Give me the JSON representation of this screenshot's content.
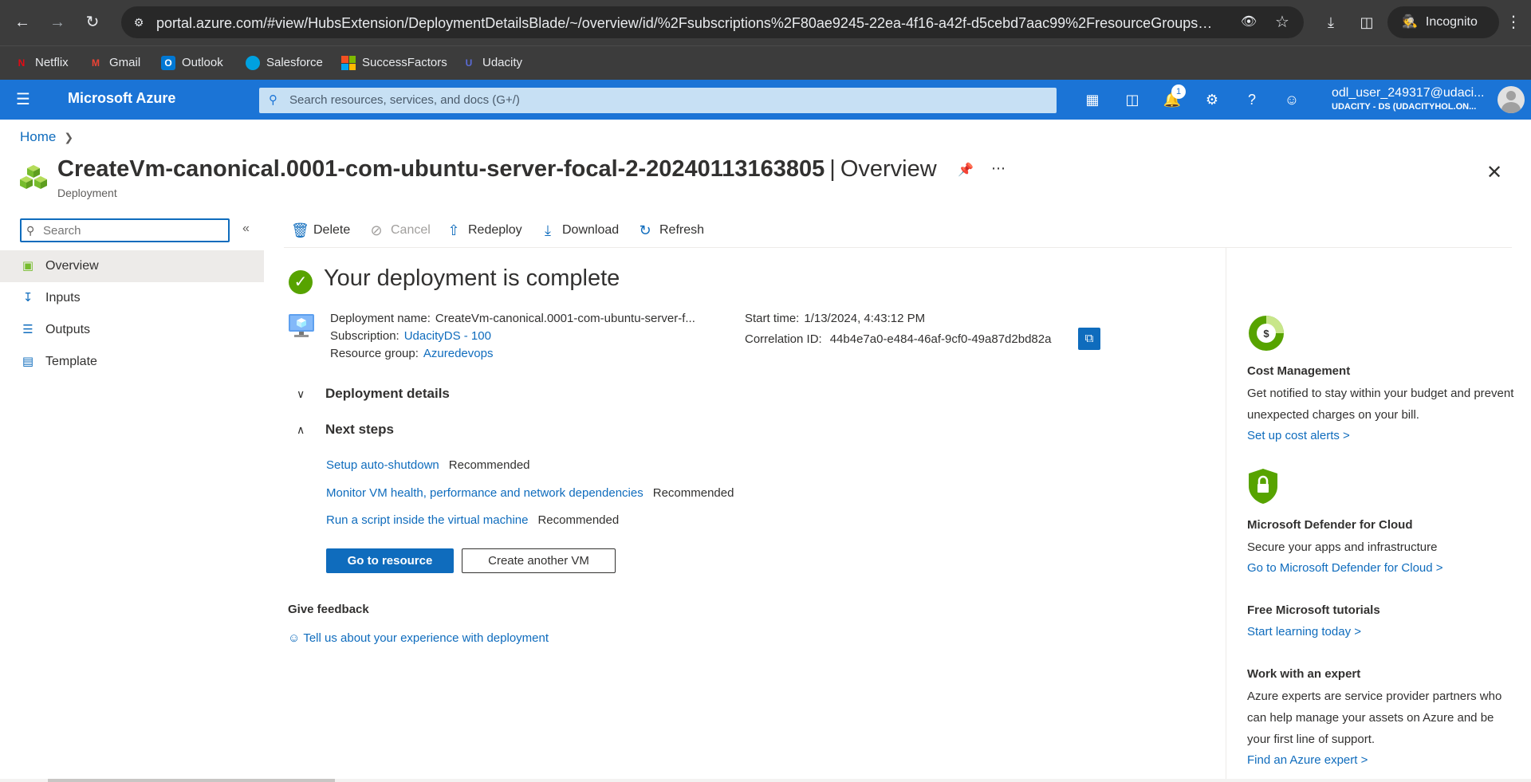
{
  "browser": {
    "url": "portal.azure.com/#view/HubsExtension/DeploymentDetailsBlade/~/overview/id/%2Fsubscriptions%2F80ae9245-22ea-4f16-a42f-d5cebd7aac99%2FresourceGroups%2FAzure...",
    "incognito_label": "Incognito",
    "bookmarks": [
      {
        "label": "Netflix",
        "icon": "netflix-icon",
        "color": "#e50914"
      },
      {
        "label": "Gmail",
        "icon": "gmail-icon",
        "color": "#ea4335"
      },
      {
        "label": "Outlook",
        "icon": "outlook-icon",
        "color": "#0078d4"
      },
      {
        "label": "Salesforce",
        "icon": "salesforce-icon",
        "color": "#00a1e0"
      },
      {
        "label": "SuccessFactors",
        "icon": "microsoft-icon",
        "color": "#f25022"
      },
      {
        "label": "Udacity",
        "icon": "udacity-icon",
        "color": "#5a6bd6"
      }
    ]
  },
  "azure": {
    "brand": "Microsoft Azure",
    "search_placeholder": "Search resources, services, and docs (G+/)",
    "notification_count": "1",
    "user": "odl_user_249317@udaci...",
    "tenant": "UDACITY - DS (UDACITYHOL.ON...",
    "accent": "#1b74d6"
  },
  "breadcrumb": {
    "home": "Home"
  },
  "blade": {
    "title": "CreateVm-canonical.0001-com-ubuntu-server-focal-2-20240113163805",
    "separator": "|",
    "section": "Overview",
    "subtitle": "Deployment"
  },
  "leftnav": {
    "search_placeholder": "Search",
    "items": [
      {
        "label": "Overview",
        "icon": "overview-icon"
      },
      {
        "label": "Inputs",
        "icon": "inputs-icon"
      },
      {
        "label": "Outputs",
        "icon": "outputs-icon"
      },
      {
        "label": "Template",
        "icon": "template-icon"
      }
    ]
  },
  "commands": {
    "delete": "Delete",
    "cancel": "Cancel",
    "redeploy": "Redeploy",
    "download": "Download",
    "refresh": "Refresh"
  },
  "deployment": {
    "status": "Your deployment is complete",
    "name_label": "Deployment name:",
    "name_value": "CreateVm-canonical.0001-com-ubuntu-server-f...",
    "subscription_label": "Subscription:",
    "subscription_value": "UdacityDS - 100",
    "rg_label": "Resource group:",
    "rg_value": "Azuredevops",
    "start_label": "Start time:",
    "start_value": "1/13/2024, 4:43:12 PM",
    "corr_label": "Correlation ID:",
    "corr_value": "44b4e7a0-e484-46af-9cf0-49a87d2bd82a",
    "success_color": "#57a300"
  },
  "sections": {
    "details": "Deployment details",
    "next_steps": "Next steps"
  },
  "next_steps": [
    {
      "link": "Setup auto-shutdown",
      "tag": "Recommended"
    },
    {
      "link": "Monitor VM health, performance and network dependencies",
      "tag": "Recommended"
    },
    {
      "link": "Run a script inside the virtual machine",
      "tag": "Recommended"
    }
  ],
  "buttons": {
    "go_to_resource": "Go to resource",
    "create_another": "Create another VM"
  },
  "feedback": {
    "title": "Give feedback",
    "link": "Tell us about your experience with deployment"
  },
  "right_panel": {
    "cost": {
      "title": "Cost Management",
      "desc": "Get notified to stay within your budget and prevent unexpected charges on your bill.",
      "link": "Set up cost alerts >"
    },
    "defender": {
      "title": "Microsoft Defender for Cloud",
      "desc": "Secure your apps and infrastructure",
      "link": "Go to Microsoft Defender for Cloud >"
    },
    "tutorials": {
      "title": "Free Microsoft tutorials",
      "link": "Start learning today >"
    },
    "expert": {
      "title": "Work with an expert",
      "desc": "Azure experts are service provider partners who can help manage your assets on Azure and be your first line of support.",
      "link": "Find an Azure expert >"
    }
  }
}
